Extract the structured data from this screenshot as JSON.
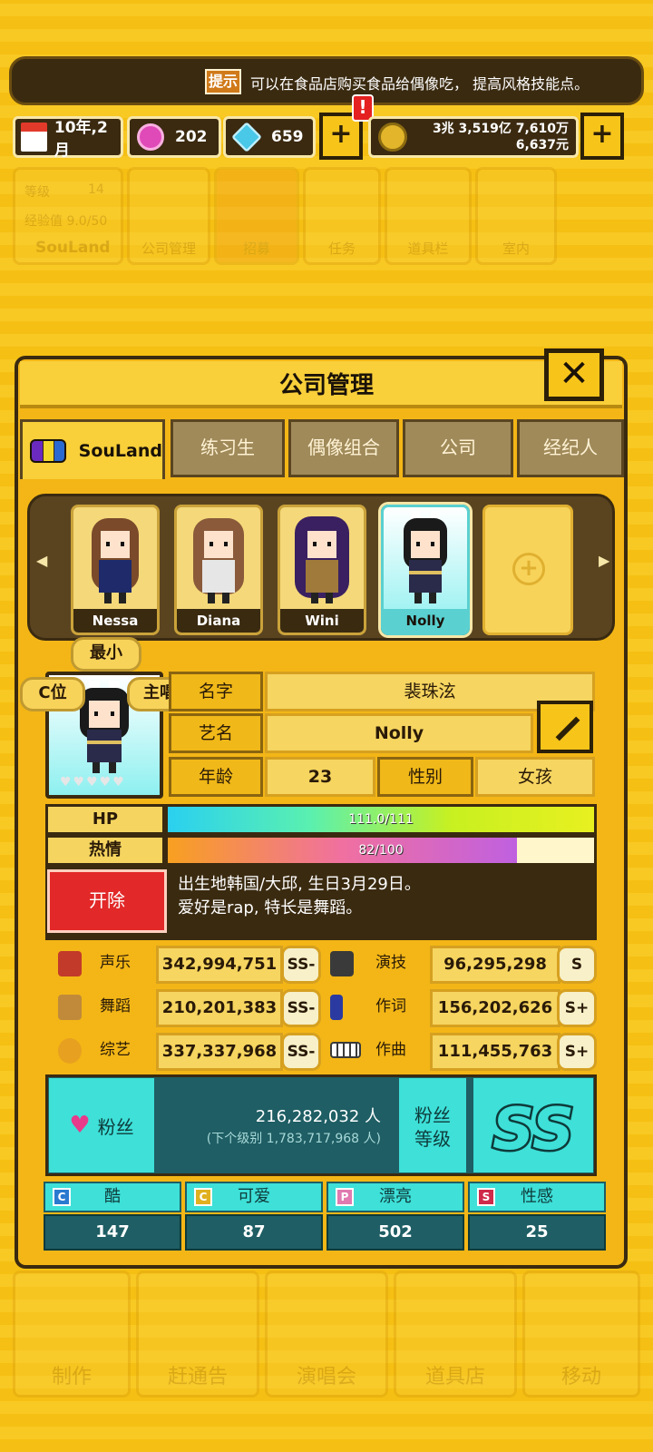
{
  "tip": {
    "badge": "提示",
    "text": "可以在食品店购买食品给偶像吃， 提高风格技能点。"
  },
  "status": {
    "date": "10年,2月",
    "pink_gems": "202",
    "blue_gems": "659",
    "money_line1": "3兆 3,519亿 7,610万",
    "money_line2": "6,637元",
    "plus": "+",
    "alert": "!"
  },
  "nav_faded": {
    "level_label": "等级",
    "level": "14",
    "exp": "经验值 9.0/50",
    "company": "SouLand",
    "tiles": [
      "公司管理",
      "招募",
      "任务",
      "道具栏",
      "室内"
    ]
  },
  "bottom_faded": [
    "制作",
    "赶通告",
    "演唱会",
    "道具店",
    "移动"
  ],
  "panel": {
    "title": "公司管理",
    "close": "✕"
  },
  "tabs": {
    "active": "SouLand",
    "others": [
      "练习生",
      "偶像组合",
      "公司",
      "经纪人"
    ]
  },
  "roster": [
    {
      "name": "Nessa",
      "hair": "#7a4a2a",
      "outfit": "#1e2a6a"
    },
    {
      "name": "Diana",
      "hair": "#8a5a3a",
      "outfit": "#e6e6e6"
    },
    {
      "name": "Wini",
      "hair": "#3a2060",
      "outfit": "#a07a3a"
    },
    {
      "name": "Nolly",
      "hair": "#1a1a1a",
      "outfit": "#2a2a4a"
    }
  ],
  "badges": {
    "youngest": "最小",
    "center": "C位",
    "vocal": "主唱"
  },
  "profile": {
    "name_label": "名字",
    "name": "裴珠泫",
    "stage_label": "艺名",
    "stage": "Nolly",
    "age_label": "年龄",
    "age": "23",
    "gender_label": "性别",
    "gender": "女孩"
  },
  "hp": {
    "label": "HP",
    "text": "111.0/111",
    "fraction": 1.0
  },
  "passion": {
    "label": "热情",
    "text": "82/100",
    "fraction": 0.82
  },
  "fire_button": "开除",
  "description": {
    "line1": "出生地韩国/大邱, 生日3月29日。",
    "line2": "爱好是rap, 特长是舞蹈。"
  },
  "skills": [
    {
      "name": "声乐",
      "value": "342,994,751",
      "grade": "SS-",
      "color": "#c23a2a"
    },
    {
      "name": "演技",
      "value": "96,295,298",
      "grade": "S",
      "color": "#3a3a3a"
    },
    {
      "name": "舞蹈",
      "value": "210,201,383",
      "grade": "SS-",
      "color": "#c08a3a"
    },
    {
      "name": "作词",
      "value": "156,202,626",
      "grade": "S+",
      "color": "#2a3aa0"
    },
    {
      "name": "综艺",
      "value": "337,337,968",
      "grade": "SS-",
      "color": "#e8a020"
    },
    {
      "name": "作曲",
      "value": "111,455,763",
      "grade": "S+",
      "color": "#3a3a3a"
    }
  ],
  "fans": {
    "label": "粉丝",
    "count": "216,282,032 人",
    "next": "(下个级别 1,783,717,968 人)",
    "level_label1": "粉丝",
    "level_label2": "等级",
    "grade": "SS"
  },
  "style": [
    {
      "letter": "C",
      "label": "酷",
      "value": "147",
      "color": "#2a7ad0"
    },
    {
      "letter": "C",
      "label": "可爱",
      "value": "87",
      "color": "#e0b020"
    },
    {
      "letter": "P",
      "label": "漂亮",
      "value": "502",
      "color": "#e07ab0"
    },
    {
      "letter": "S",
      "label": "性感",
      "value": "25",
      "color": "#d02a4a"
    }
  ]
}
